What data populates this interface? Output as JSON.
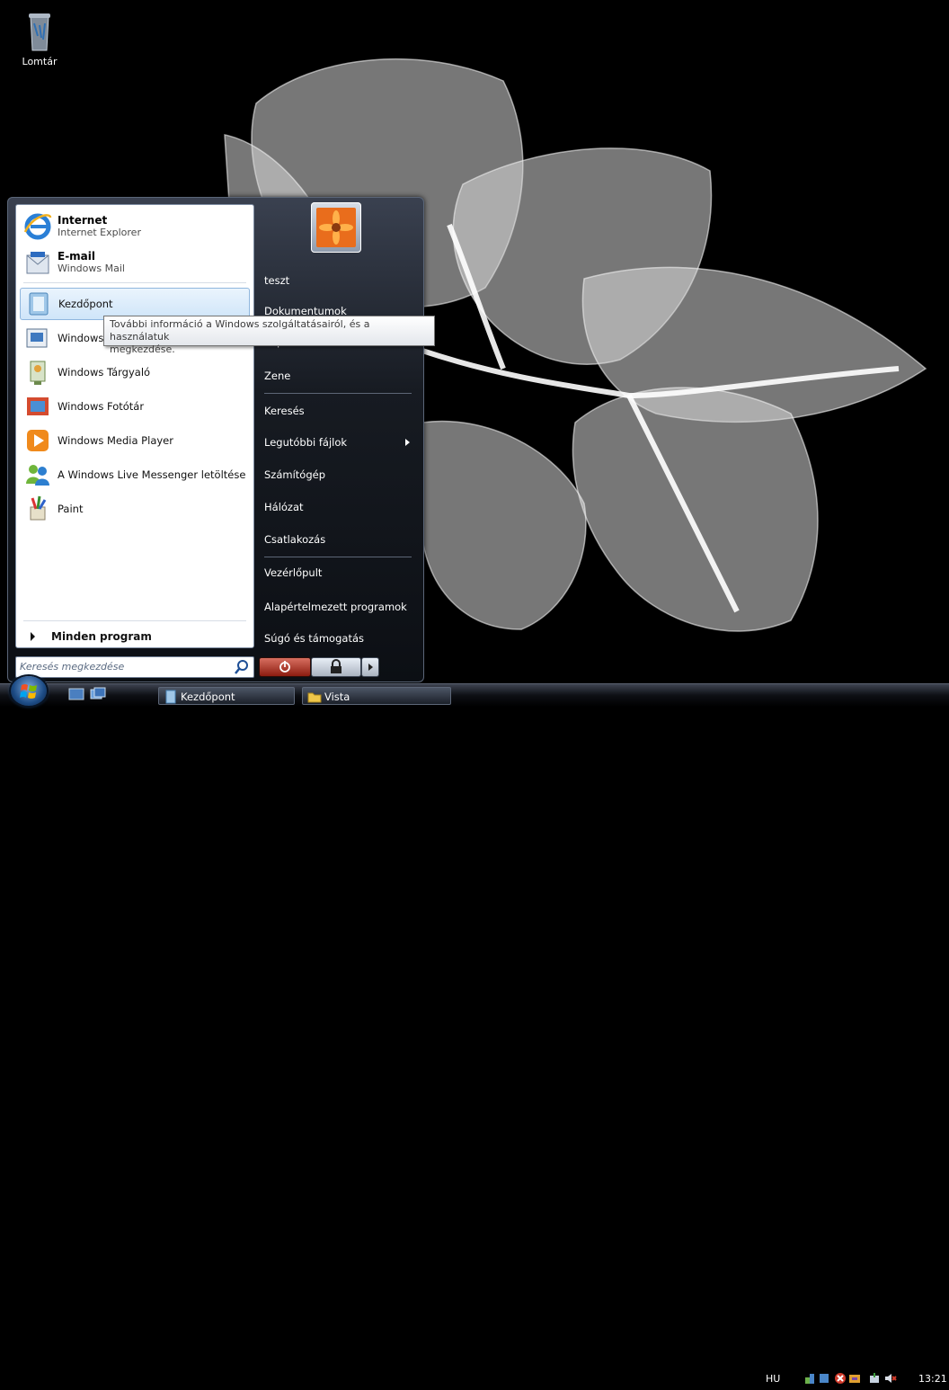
{
  "desktop": {
    "icons": [
      {
        "label": "Lomtár",
        "icon": "recycle-bin-icon"
      }
    ]
  },
  "start_menu": {
    "pinned": [
      {
        "title": "Internet",
        "subtitle": "Internet Explorer",
        "icon": "internet-explorer-icon"
      },
      {
        "title": "E-mail",
        "subtitle": "Windows Mail",
        "icon": "windows-mail-icon"
      }
    ],
    "recent_programs": [
      {
        "label": "Kezdőpont",
        "icon": "welcome-center-icon",
        "highlighted": true
      },
      {
        "label": "Windows M",
        "icon": "windows-movie-maker-icon"
      },
      {
        "label": "Windows Tárgyaló",
        "icon": "windows-meeting-space-icon"
      },
      {
        "label": "Windows Fotótár",
        "icon": "windows-photo-gallery-icon"
      },
      {
        "label": "Windows Media Player",
        "icon": "windows-media-player-icon"
      },
      {
        "label": "A Windows Live Messenger letöltése",
        "icon": "windows-live-messenger-icon"
      },
      {
        "label": "Paint",
        "icon": "paint-icon"
      }
    ],
    "all_programs": "Minden program",
    "search_placeholder": "Keresés megkezdése",
    "tooltip": {
      "line1": "További információ a Windows szolgáltatásairól, és a használatuk",
      "line2": "megkezdése."
    },
    "user_name": "teszt",
    "right_items": [
      {
        "label": "Dokumentumok"
      },
      {
        "label": "Képek"
      },
      {
        "label": "Zene"
      },
      {
        "label": "Keresés"
      },
      {
        "label": "Legutóbbi fájlok",
        "has_submenu": true
      },
      {
        "label": "Számítógép"
      },
      {
        "label": "Hálózat"
      },
      {
        "label": "Csatlakozás"
      },
      {
        "label": "Vezérlőpult"
      },
      {
        "label": "Alapértelmezett programok"
      },
      {
        "label": "Súgó és támogatás"
      }
    ],
    "buttons": {
      "power": "power-icon",
      "lock": "lock-icon",
      "more": "chevron-right-icon"
    }
  },
  "taskbar": {
    "buttons": [
      {
        "label": "Kezdőpont",
        "icon": "welcome-center-icon"
      },
      {
        "label": "Vista",
        "icon": "folder-icon"
      }
    ],
    "language": "HU",
    "clock": "13:21"
  },
  "colors": {
    "start_menu_bg": "#171b22",
    "highlight": "#cfe5f9",
    "taskbar_bg": "#0d0f14"
  }
}
